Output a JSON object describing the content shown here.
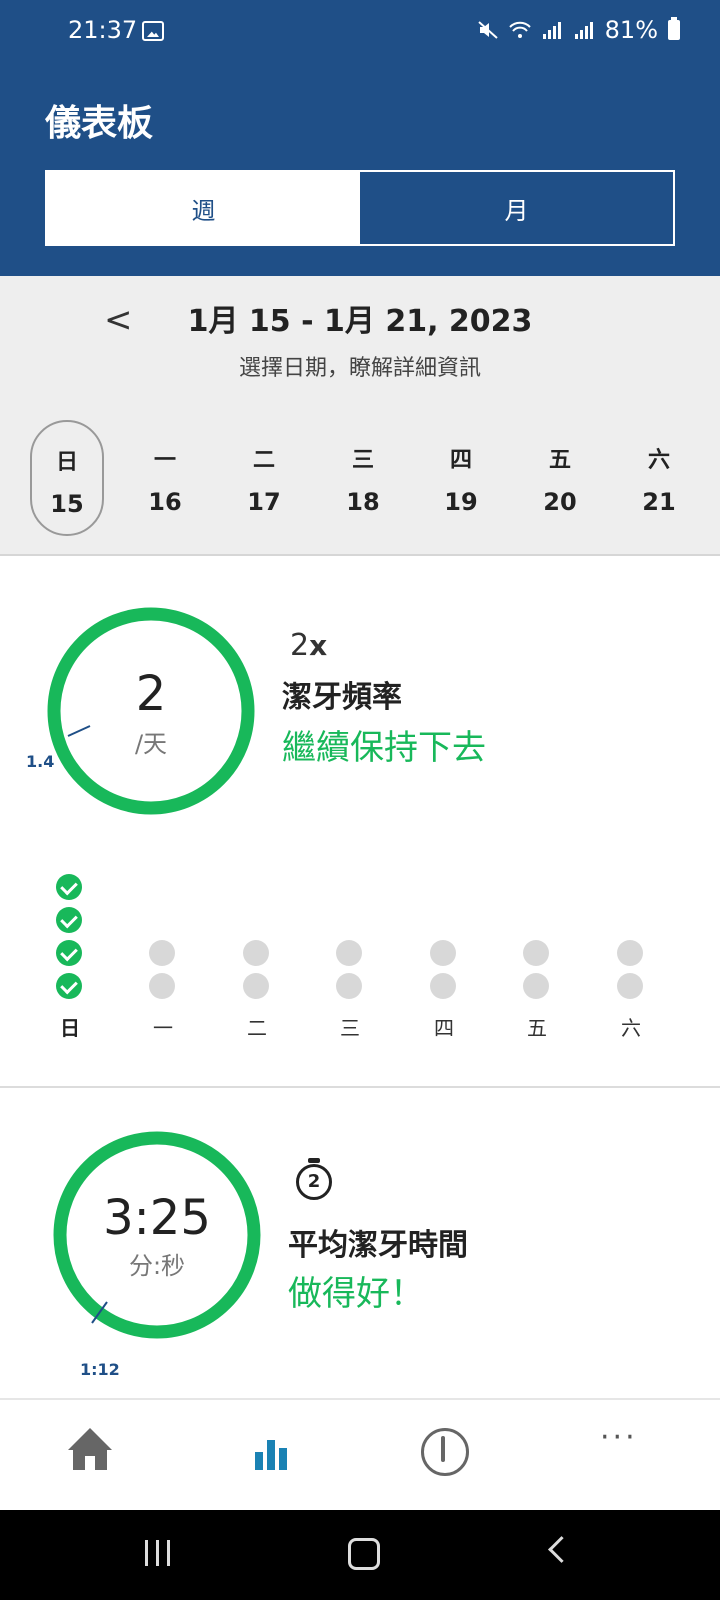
{
  "status_bar": {
    "time": "21:37",
    "battery": "81%"
  },
  "header": {
    "title": "儀表板",
    "tabs": [
      {
        "label": "週"
      },
      {
        "label": "月"
      }
    ]
  },
  "date_nav": {
    "range": "1月 15 - 1月 21, 2023",
    "hint": "選擇日期，瞭解詳細資訊",
    "days": [
      {
        "name": "日",
        "date": "15"
      },
      {
        "name": "一",
        "date": "16"
      },
      {
        "name": "二",
        "date": "17"
      },
      {
        "name": "三",
        "date": "18"
      },
      {
        "name": "四",
        "date": "19"
      },
      {
        "name": "五",
        "date": "20"
      },
      {
        "name": "六",
        "date": "21"
      }
    ]
  },
  "frequency": {
    "value": "2",
    "unit": "/天",
    "average": "1.4",
    "goal_num": "2",
    "goal_x": "x",
    "title": "潔牙頻率",
    "message": "繼續保持下去",
    "days": [
      {
        "label": "日",
        "done": 4,
        "total": 4
      },
      {
        "label": "一",
        "done": 0,
        "total": 2
      },
      {
        "label": "二",
        "done": 0,
        "total": 2
      },
      {
        "label": "三",
        "done": 0,
        "total": 2
      },
      {
        "label": "四",
        "done": 0,
        "total": 2
      },
      {
        "label": "五",
        "done": 0,
        "total": 2
      },
      {
        "label": "六",
        "done": 0,
        "total": 2
      }
    ]
  },
  "duration": {
    "value": "3:25",
    "unit": "分:秒",
    "average": "1:12",
    "timer_badge": "2",
    "title": "平均潔牙時間",
    "message": "做得好！"
  },
  "colors": {
    "brand": "#1f4f87",
    "success": "#18b85a",
    "accent": "#1a82b4"
  },
  "bottom_nav": [
    {
      "icon": "home-icon"
    },
    {
      "icon": "bar-chart-icon"
    },
    {
      "icon": "brush-head-icon"
    },
    {
      "icon": "more-icon"
    }
  ]
}
